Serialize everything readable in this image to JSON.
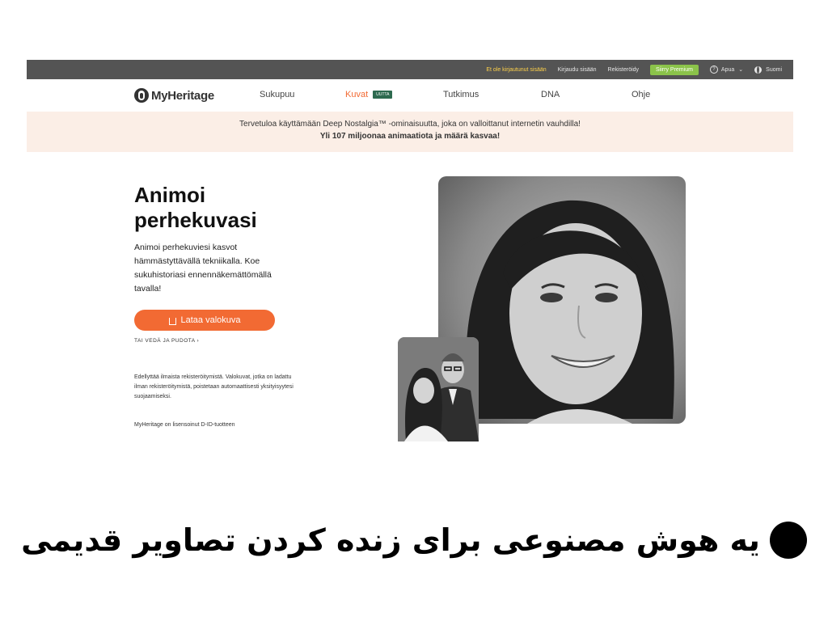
{
  "topbar": {
    "not_logged_in": "Et ole kirjautunut sisään",
    "login": "Kirjaudu sisään",
    "register": "Rekisteröidy",
    "premium": "Siirry Premium",
    "help": "Apua",
    "language": "Suomi"
  },
  "nav": {
    "logo": "MyHeritage",
    "items": [
      "Sukupuu",
      "Kuvat",
      "Tutkimus",
      "DNA",
      "Ohje"
    ],
    "new_badge": "UUTTA"
  },
  "banner": {
    "line1": "Tervetuloa käyttämään Deep Nostalgia™ -ominaisuutta, joka on valloittanut internetin vauhdilla!",
    "line2": "Yli 107 miljoonaa animaatiota ja määrä kasvaa!"
  },
  "hero": {
    "title_line1": "Animoi",
    "title_line2": "perhekuvasi",
    "description": "Animoi perhekuviesi kasvot hämmästyttävällä tekniikalla. Koe sukuhistoriasi ennennäkemättömällä tavalla!",
    "upload_button": "Lataa valokuva",
    "drag_drop": "TAI VEDÄ JA PUDOTA",
    "legal": "Edellyttää ilmaista rekisteröitymistä. Valokuvat, jotka on ladattu ilman rekisteröitymistä, poistetaan automaattisesti yksityisyytesi suojaamiseksi.",
    "license": "MyHeritage on lisensoinut D-ID-tuotteen"
  },
  "caption": {
    "text": "یه هوش مصنوعی برای زنده کردن تصاویر قدیمی"
  },
  "colors": {
    "accent": "#f26a33",
    "premium": "#8bc34a",
    "topbar": "#545454",
    "banner": "#fbeee6",
    "badge": "#2d6a4f"
  }
}
